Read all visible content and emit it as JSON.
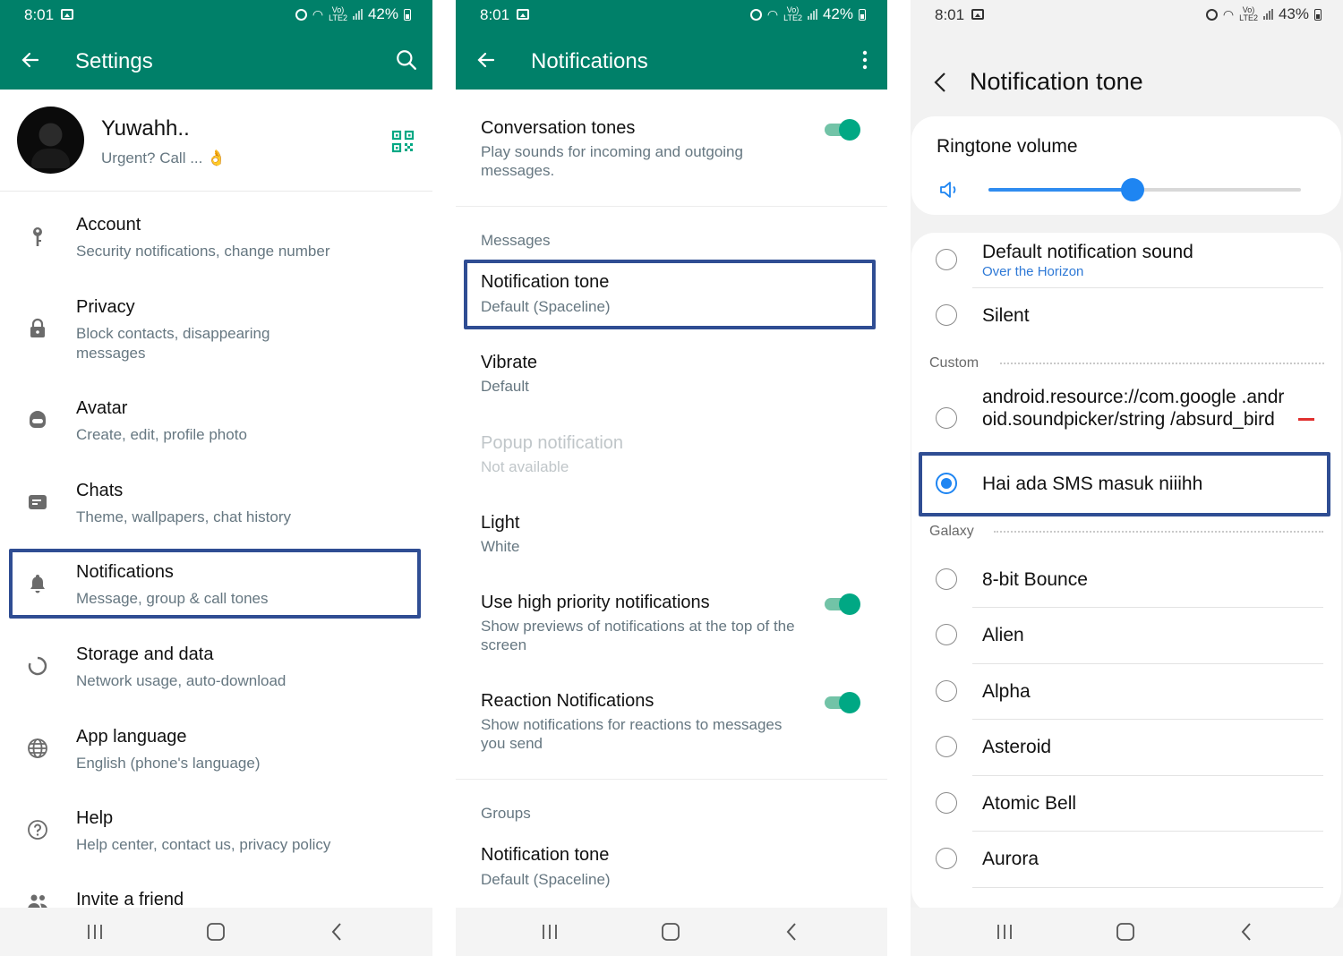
{
  "panel1": {
    "status": {
      "time": "8:01",
      "battery": "42%",
      "net_top": "Vo)",
      "net_bottom": "LTE2"
    },
    "appbar_title": "Settings",
    "profile": {
      "name": "Yuwahh..",
      "about": "Urgent? Call ... 👌"
    },
    "items": [
      {
        "title": "Account",
        "subtitle": "Security notifications, change number",
        "icon": "key-icon"
      },
      {
        "title": "Privacy",
        "subtitle": "Block contacts, disappearing messages",
        "icon": "lock-icon"
      },
      {
        "title": "Avatar",
        "subtitle": "Create, edit, profile photo",
        "icon": "avatar-face-icon"
      },
      {
        "title": "Chats",
        "subtitle": "Theme, wallpapers, chat history",
        "icon": "chat-icon"
      },
      {
        "title": "Notifications",
        "subtitle": "Message, group & call tones",
        "icon": "bell-icon"
      },
      {
        "title": "Storage and data",
        "subtitle": "Network usage, auto-download",
        "icon": "storage-ring-icon"
      },
      {
        "title": "App language",
        "subtitle": "English (phone's language)",
        "icon": "globe-icon"
      },
      {
        "title": "Help",
        "subtitle": "Help center, contact us, privacy policy",
        "icon": "help-icon"
      },
      {
        "title": "Invite a friend",
        "subtitle": "",
        "icon": "people-icon"
      }
    ]
  },
  "panel2": {
    "status": {
      "time": "8:01",
      "battery": "42%",
      "net_top": "Vo)",
      "net_bottom": "LTE2"
    },
    "appbar_title": "Notifications",
    "conversation_tones": {
      "title": "Conversation tones",
      "subtitle": "Play sounds for incoming and outgoing messages.",
      "enabled": true
    },
    "messages_section": "Messages",
    "notification_tone": {
      "title": "Notification tone",
      "subtitle": "Default (Spaceline)"
    },
    "vibrate": {
      "title": "Vibrate",
      "subtitle": "Default"
    },
    "popup": {
      "title": "Popup notification",
      "subtitle": "Not available"
    },
    "light": {
      "title": "Light",
      "subtitle": "White"
    },
    "high_priority": {
      "title": "Use high priority notifications",
      "subtitle": "Show previews of notifications at the top of the screen",
      "enabled": true
    },
    "reactions": {
      "title": "Reaction Notifications",
      "subtitle": "Show notifications for reactions to messages you send",
      "enabled": true
    },
    "groups_section": "Groups",
    "group_tone": {
      "title": "Notification tone",
      "subtitle": "Default (Spaceline)"
    }
  },
  "panel3": {
    "status": {
      "time": "8:01",
      "battery": "43%",
      "net_top": "Vo)",
      "net_bottom": "LTE2"
    },
    "title": "Notification tone",
    "volume_label": "Ringtone volume",
    "volume_level": 0.46,
    "default_sound": {
      "label": "Default notification sound",
      "subtitle": "Over the Horizon"
    },
    "silent": "Silent",
    "custom_section": "Custom",
    "custom_items": [
      {
        "label": "android.resource://com.google .android.soundpicker/string /absurd_bird",
        "selected": false
      },
      {
        "label": "Hai ada SMS masuk niiihh",
        "selected": true
      }
    ],
    "galaxy_section": "Galaxy",
    "galaxy_items": [
      "8-bit Bounce",
      "Alien",
      "Alpha",
      "Asteroid",
      "Atomic Bell",
      "Aurora"
    ]
  },
  "colors": {
    "whatsapp_green": "#008069",
    "toggle_on": "#00a884",
    "highlight_box": "#2f4d93",
    "samsung_blue": "#1e85f2",
    "link_blue": "#2e79d6",
    "remove_red": "#e0302e"
  }
}
